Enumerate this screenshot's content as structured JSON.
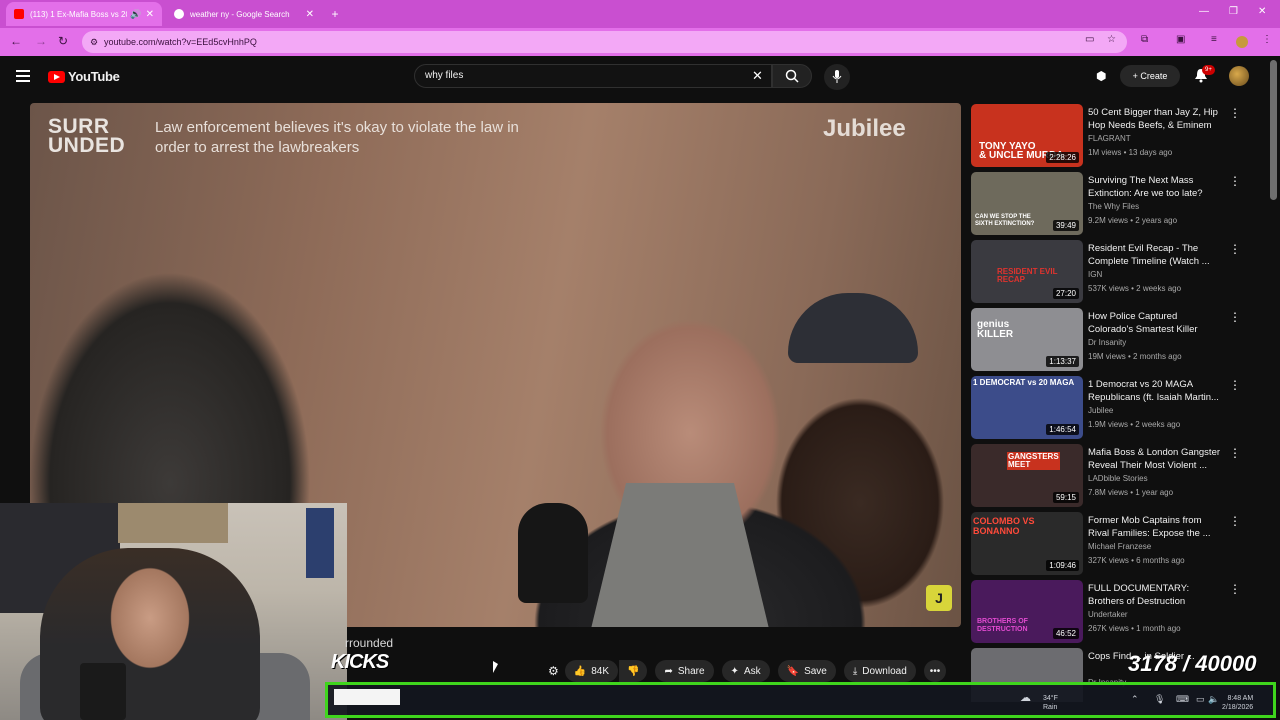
{
  "browser": {
    "tabs": [
      {
        "title": "(113) 1 Ex-Mafia Boss vs 20",
        "active": true
      },
      {
        "title": "weather ny - Google Search",
        "active": false
      }
    ],
    "url": "youtube.com/watch?v=EEd5cvHnhPQ",
    "new_tab": "+",
    "close_glyph": "✕"
  },
  "header": {
    "logo_text": "YouTube",
    "search_value": "why files",
    "create_label": "Create",
    "notification_badge": "9+"
  },
  "player": {
    "overlay_brand_left": "SURR\nUNDED",
    "overlay_caption": "Law enforcement believes it's okay to violate the law in order to arrest the lawbreakers",
    "overlay_brand_right": "Jubilee",
    "corner_logo": "J"
  },
  "video": {
    "title_fragment": "rrounded",
    "likes": "84K",
    "share_label": "Share",
    "ask_label": "Ask",
    "save_label": "Save",
    "download_label": "Download"
  },
  "stream_overlay": {
    "kicks_label": "KICKS",
    "counter": "3178 / 40000"
  },
  "recommendations": [
    {
      "title": "50 Cent Bigger than Jay Z, Hip Hop Needs Beefs, & Eminem i...",
      "channel": "FLAGRANT",
      "meta": "1M views • 13 days ago",
      "duration": "2:28:26",
      "thumb_text": "TONY YAYO\n& UNCLE MURDA",
      "color": "#c8321e"
    },
    {
      "title": "Surviving The Next Mass Extinction: Are we too late?",
      "channel": "The Why Files",
      "meta": "9.2M views • 2 years ago",
      "duration": "39:49",
      "thumb_text": "CAN WE STOP THE\nSIXTH EXTINCTION?",
      "color": "#6e6a5c"
    },
    {
      "title": "Resident Evil Recap - The Complete Timeline (Watch ...",
      "channel": "IGN",
      "meta": "537K views • 2 weeks ago",
      "duration": "27:20",
      "thumb_text": "RESIDENT EVIL\nRECAP",
      "color": "#3a3a40"
    },
    {
      "title": "How Police Captured Colorado's Smartest Killer",
      "channel": "Dr Insanity",
      "meta": "19M views • 2 months ago",
      "duration": "1:13:37",
      "thumb_text": "genius\nKILLER",
      "color": "#8e8e92"
    },
    {
      "title": "1 Democrat vs 20 MAGA Republicans (ft. Isaiah Martin...",
      "channel": "Jubilee",
      "meta": "1.9M views • 2 weeks ago",
      "duration": "1:46:54",
      "thumb_text": "1 DEMOCRAT vs 20 MAGA",
      "color": "#3c4c8a"
    },
    {
      "title": "Mafia Boss & London Gangster Reveal Their Most Violent ...",
      "channel": "LADbible Stories",
      "meta": "7.8M views • 1 year ago",
      "duration": "59:15",
      "thumb_text": "GANGSTERS\nMEET",
      "color": "#3a2a2a"
    },
    {
      "title": "Former Mob Captains from Rival Families: Expose the ...",
      "channel": "Michael Franzese",
      "meta": "327K views • 6 months ago",
      "duration": "1:09:46",
      "thumb_text": "COLOMBO VS BONANNO",
      "color": "#2a2a2a"
    },
    {
      "title": "FULL DOCUMENTARY: Brothers of Destruction",
      "channel": "Undertaker",
      "meta": "267K views • 1 month ago",
      "duration": "46:52",
      "thumb_text": "BROTHERS OF\nDESTRUCTION",
      "color": "#4a1a5c"
    },
    {
      "title": "Cops Find ... in Soldier ...",
      "channel": "Dr Insanity",
      "meta": "",
      "duration": "",
      "thumb_text": "",
      "color": "#6c6c70"
    }
  ],
  "taskbar": {
    "weather_temp": "34°F",
    "weather_desc": "Rain",
    "time": "8:48 AM",
    "date": "2/18/2026"
  },
  "colors": {
    "tab_bar": "#c94fd0",
    "nav_bar": "#e36fe9",
    "youtube_red": "#ff0000",
    "taskbar_border": "#3fd51d"
  },
  "icons": [
    "speaker-icon",
    "search-icon",
    "mic-icon",
    "bell-icon",
    "like-icon",
    "dislike-icon",
    "share-icon",
    "ask-icon",
    "save-icon",
    "download-icon",
    "more-icon"
  ]
}
